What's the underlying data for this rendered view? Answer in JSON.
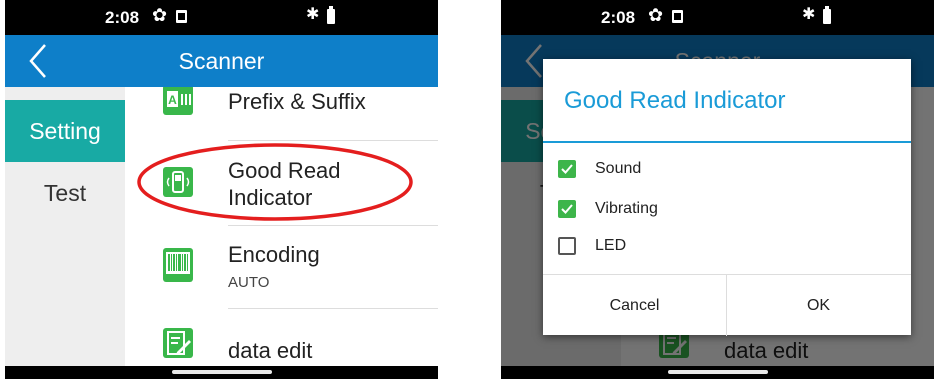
{
  "status_bar": {
    "time": "2:08"
  },
  "app_bar": {
    "title": "Scanner"
  },
  "sidebar": {
    "items": [
      {
        "label": "Setting"
      },
      {
        "label": "Test"
      }
    ]
  },
  "settings_list": {
    "prefix_suffix": {
      "label": "Prefix & Suffix"
    },
    "good_read": {
      "label_line1": "Good Read",
      "label_line2": "Indicator"
    },
    "encoding": {
      "label": "Encoding",
      "value": "AUTO"
    },
    "data_edit": {
      "label": "data edit"
    }
  },
  "dialog": {
    "title": "Good Read Indicator",
    "options": [
      {
        "label": "Sound",
        "checked": true
      },
      {
        "label": "Vibrating",
        "checked": true
      },
      {
        "label": "LED",
        "checked": false
      }
    ],
    "cancel_label": "Cancel",
    "ok_label": "OK"
  },
  "colors": {
    "app_bar": "#0e7fc9",
    "sidebar_active": "#18aaa4",
    "icon_green": "#39b74a",
    "highlight_ellipse": "#e41e1e",
    "dialog_accent": "#1a9bd7"
  }
}
